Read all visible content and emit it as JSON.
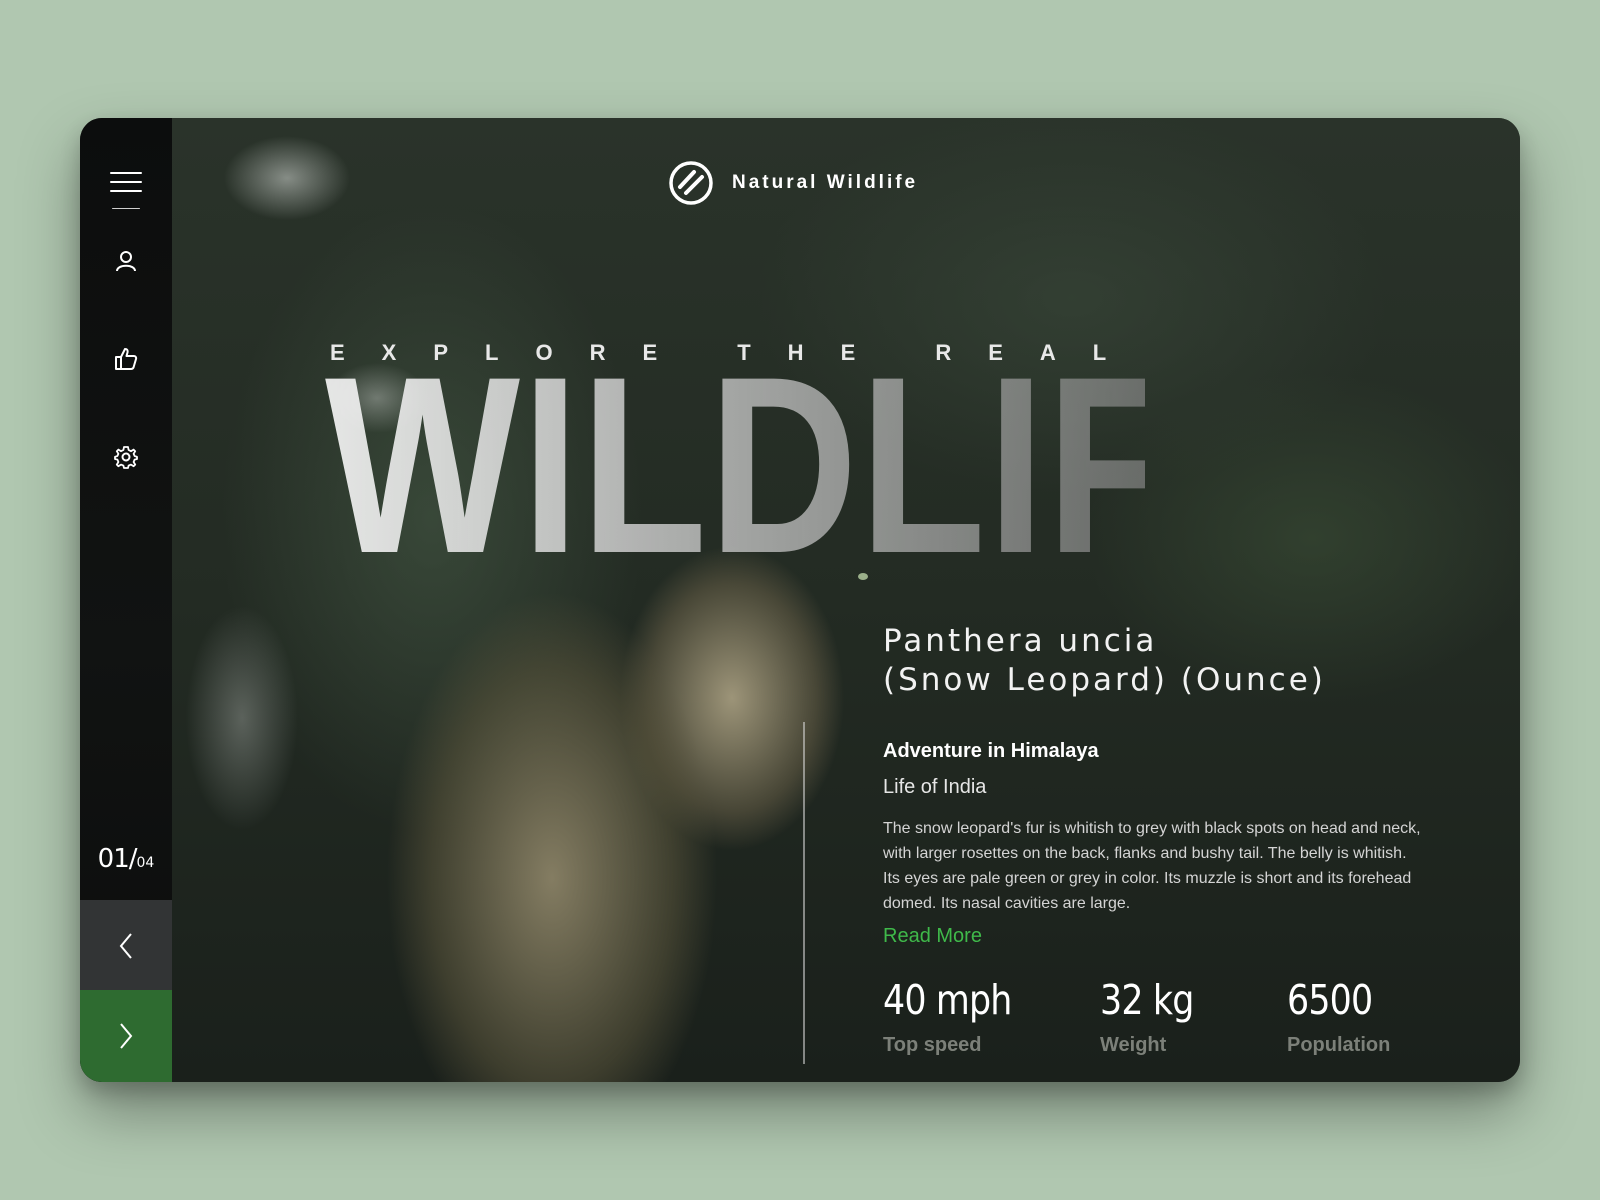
{
  "brand": {
    "name": "Natural Wildlife"
  },
  "hero": {
    "kicker": "EXPLORE THE REAL",
    "title": "WILDLIFE"
  },
  "species": {
    "line1": "Panthera uncia",
    "line2": "(Snow Leopard) (Ounce)"
  },
  "article": {
    "subtitle": "Adventure in Himalaya",
    "location": "Life of India",
    "description": "The snow leopard's fur is whitish to grey with black spots on head and neck, with larger rosettes on the back, flanks and bushy tail. The belly is whitish. Its eyes are pale green or grey in color. Its muzzle is short and its forehead domed. Its nasal cavities are large.",
    "read_more": "Read More"
  },
  "stats": [
    {
      "value": "40 mph",
      "label": "Top speed"
    },
    {
      "value": "32 kg",
      "label": "Weight"
    },
    {
      "value": "6500",
      "label": "Population"
    }
  ],
  "pager": {
    "current": "01/",
    "total": "04"
  },
  "sidebar": {
    "icons": [
      "menu-icon",
      "user-icon",
      "thumbs-up-icon",
      "gear-icon"
    ]
  },
  "nav": {
    "prev_icon": "chevron-left-icon",
    "next_icon": "chevron-right-icon"
  },
  "colors": {
    "page_bg": "#b0c7b0",
    "accent": "#3fb94a",
    "next_btn": "#2e6b30",
    "prev_btn": "#323435"
  }
}
